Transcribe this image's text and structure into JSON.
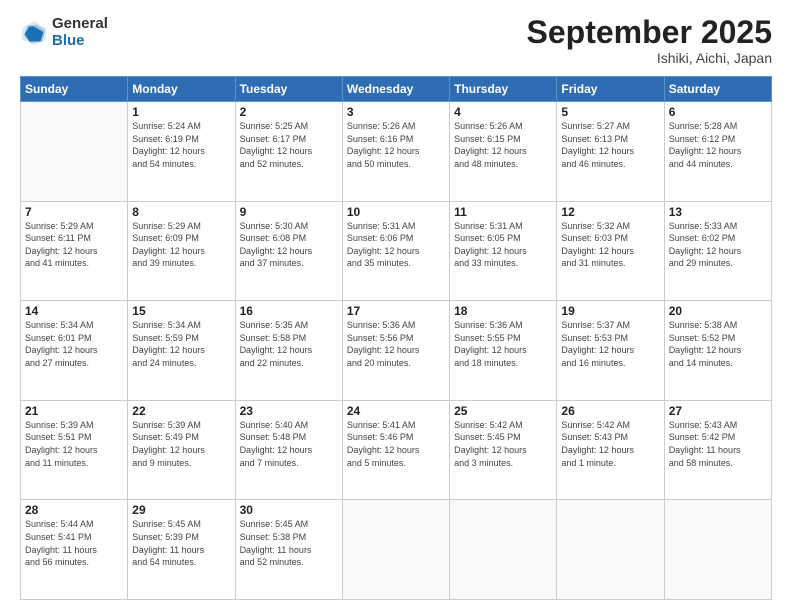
{
  "logo": {
    "general": "General",
    "blue": "Blue"
  },
  "header": {
    "month": "September 2025",
    "location": "Ishiki, Aichi, Japan"
  },
  "weekdays": [
    "Sunday",
    "Monday",
    "Tuesday",
    "Wednesday",
    "Thursday",
    "Friday",
    "Saturday"
  ],
  "weeks": [
    [
      {
        "day": "",
        "info": ""
      },
      {
        "day": "1",
        "info": "Sunrise: 5:24 AM\nSunset: 6:19 PM\nDaylight: 12 hours\nand 54 minutes."
      },
      {
        "day": "2",
        "info": "Sunrise: 5:25 AM\nSunset: 6:17 PM\nDaylight: 12 hours\nand 52 minutes."
      },
      {
        "day": "3",
        "info": "Sunrise: 5:26 AM\nSunset: 6:16 PM\nDaylight: 12 hours\nand 50 minutes."
      },
      {
        "day": "4",
        "info": "Sunrise: 5:26 AM\nSunset: 6:15 PM\nDaylight: 12 hours\nand 48 minutes."
      },
      {
        "day": "5",
        "info": "Sunrise: 5:27 AM\nSunset: 6:13 PM\nDaylight: 12 hours\nand 46 minutes."
      },
      {
        "day": "6",
        "info": "Sunrise: 5:28 AM\nSunset: 6:12 PM\nDaylight: 12 hours\nand 44 minutes."
      }
    ],
    [
      {
        "day": "7",
        "info": "Sunrise: 5:29 AM\nSunset: 6:11 PM\nDaylight: 12 hours\nand 41 minutes."
      },
      {
        "day": "8",
        "info": "Sunrise: 5:29 AM\nSunset: 6:09 PM\nDaylight: 12 hours\nand 39 minutes."
      },
      {
        "day": "9",
        "info": "Sunrise: 5:30 AM\nSunset: 6:08 PM\nDaylight: 12 hours\nand 37 minutes."
      },
      {
        "day": "10",
        "info": "Sunrise: 5:31 AM\nSunset: 6:06 PM\nDaylight: 12 hours\nand 35 minutes."
      },
      {
        "day": "11",
        "info": "Sunrise: 5:31 AM\nSunset: 6:05 PM\nDaylight: 12 hours\nand 33 minutes."
      },
      {
        "day": "12",
        "info": "Sunrise: 5:32 AM\nSunset: 6:03 PM\nDaylight: 12 hours\nand 31 minutes."
      },
      {
        "day": "13",
        "info": "Sunrise: 5:33 AM\nSunset: 6:02 PM\nDaylight: 12 hours\nand 29 minutes."
      }
    ],
    [
      {
        "day": "14",
        "info": "Sunrise: 5:34 AM\nSunset: 6:01 PM\nDaylight: 12 hours\nand 27 minutes."
      },
      {
        "day": "15",
        "info": "Sunrise: 5:34 AM\nSunset: 5:59 PM\nDaylight: 12 hours\nand 24 minutes."
      },
      {
        "day": "16",
        "info": "Sunrise: 5:35 AM\nSunset: 5:58 PM\nDaylight: 12 hours\nand 22 minutes."
      },
      {
        "day": "17",
        "info": "Sunrise: 5:36 AM\nSunset: 5:56 PM\nDaylight: 12 hours\nand 20 minutes."
      },
      {
        "day": "18",
        "info": "Sunrise: 5:36 AM\nSunset: 5:55 PM\nDaylight: 12 hours\nand 18 minutes."
      },
      {
        "day": "19",
        "info": "Sunrise: 5:37 AM\nSunset: 5:53 PM\nDaylight: 12 hours\nand 16 minutes."
      },
      {
        "day": "20",
        "info": "Sunrise: 5:38 AM\nSunset: 5:52 PM\nDaylight: 12 hours\nand 14 minutes."
      }
    ],
    [
      {
        "day": "21",
        "info": "Sunrise: 5:39 AM\nSunset: 5:51 PM\nDaylight: 12 hours\nand 11 minutes."
      },
      {
        "day": "22",
        "info": "Sunrise: 5:39 AM\nSunset: 5:49 PM\nDaylight: 12 hours\nand 9 minutes."
      },
      {
        "day": "23",
        "info": "Sunrise: 5:40 AM\nSunset: 5:48 PM\nDaylight: 12 hours\nand 7 minutes."
      },
      {
        "day": "24",
        "info": "Sunrise: 5:41 AM\nSunset: 5:46 PM\nDaylight: 12 hours\nand 5 minutes."
      },
      {
        "day": "25",
        "info": "Sunrise: 5:42 AM\nSunset: 5:45 PM\nDaylight: 12 hours\nand 3 minutes."
      },
      {
        "day": "26",
        "info": "Sunrise: 5:42 AM\nSunset: 5:43 PM\nDaylight: 12 hours\nand 1 minute."
      },
      {
        "day": "27",
        "info": "Sunrise: 5:43 AM\nSunset: 5:42 PM\nDaylight: 11 hours\nand 58 minutes."
      }
    ],
    [
      {
        "day": "28",
        "info": "Sunrise: 5:44 AM\nSunset: 5:41 PM\nDaylight: 11 hours\nand 56 minutes."
      },
      {
        "day": "29",
        "info": "Sunrise: 5:45 AM\nSunset: 5:39 PM\nDaylight: 11 hours\nand 54 minutes."
      },
      {
        "day": "30",
        "info": "Sunrise: 5:45 AM\nSunset: 5:38 PM\nDaylight: 11 hours\nand 52 minutes."
      },
      {
        "day": "",
        "info": ""
      },
      {
        "day": "",
        "info": ""
      },
      {
        "day": "",
        "info": ""
      },
      {
        "day": "",
        "info": ""
      }
    ]
  ]
}
